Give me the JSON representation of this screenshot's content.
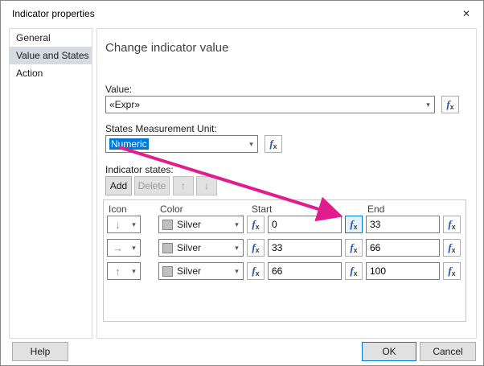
{
  "dialog": {
    "title": "Indicator properties"
  },
  "glyphs": {
    "close": "✕",
    "caret": "▾",
    "fx_f": "f",
    "fx_x": "x",
    "move_up": "↑",
    "move_down": "↓"
  },
  "sidebar": {
    "items": [
      {
        "label": "General"
      },
      {
        "label": "Value and States"
      },
      {
        "label": "Action"
      }
    ]
  },
  "main": {
    "heading": "Change indicator value",
    "value_label": "Value:",
    "value_text": "«Expr»",
    "unit_label": "States Measurement Unit:",
    "unit_value": "Numeric",
    "states_label": "Indicator states:",
    "add_label": "Add",
    "delete_label": "Delete",
    "table": {
      "headers": [
        "Icon",
        "Color",
        "Start",
        "End"
      ],
      "rows": [
        {
          "icon": "down-arrow",
          "icon_glyph": "↓",
          "color": "Silver",
          "start": "0",
          "end": "33"
        },
        {
          "icon": "right-arrow",
          "icon_glyph": "→",
          "color": "Silver",
          "start": "33",
          "end": "66"
        },
        {
          "icon": "up-arrow",
          "icon_glyph": "↑",
          "color": "Silver",
          "start": "66",
          "end": "100"
        }
      ]
    }
  },
  "footer": {
    "help": "Help",
    "ok": "OK",
    "cancel": "Cancel"
  },
  "colors": {
    "accent": "#0078d7",
    "arrow_annotation": "#e01c8e",
    "silver": "#c0c0c0"
  }
}
